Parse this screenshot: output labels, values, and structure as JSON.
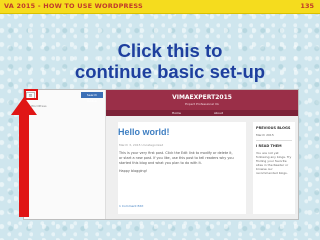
{
  "slide": {
    "header_title": "VA 2015  -  HOW TO USE WORDPRESS",
    "page_number": "135",
    "headline_line1": "Click this  to",
    "headline_line2": "continue basic set-up"
  },
  "screenshot": {
    "menu_button": "≡",
    "search_label": "Search Toolbar",
    "nav_label": "WordPress",
    "site_title": "VIMAEXPERT2015",
    "site_tagline": "Expert Professional VA",
    "nav_home": "Home",
    "nav_about": "About",
    "post_title": "Hello world!",
    "post_meta": "March 3, 2015    Uncategorized",
    "post_body": "This is your very first post. Click the Edit link to modify or delete it, or start a new post. If you like, use this post to tell readers why you started this blog and what you plan to do with it.",
    "post_signoff": "Happy blogging!",
    "post_footer": "1 Comment    Edit",
    "widget1_title": "PREVIOUS BLOGS",
    "widget1_text": "March 2015",
    "widget2_title": "I READ THEM",
    "widget2_text": "You are not yet following any blogs. Try finding your favorite sites in the Reader or browse our recommended blogs."
  },
  "colors": {
    "header_bar": "#f5dc1e",
    "header_text": "#c0392b",
    "headline": "#1e3f9e",
    "site_header": "#9a2f48",
    "highlight": "#e01515"
  },
  "icons": [
    "menu-icon",
    "up-arrow-icon"
  ]
}
